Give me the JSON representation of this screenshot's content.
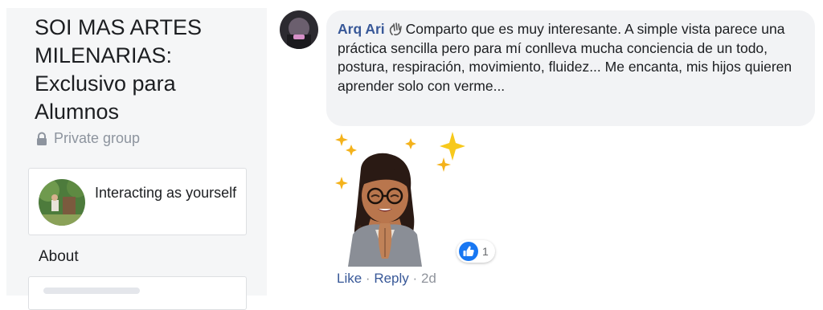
{
  "sidebar": {
    "group_title": "SOI MAS ARTES MILENARIAS: Exclusivo para Alumnos",
    "privacy": "Private group",
    "interacting": "Interacting as yourself",
    "about": "About"
  },
  "comment": {
    "author": "Arq Ari",
    "text": "Comparto que es muy interesante. A simple vista parece una práctica sencilla pero para mí conlleva mucha conciencia de un todo, postura, respiración, movimiento, fluidez... Me encanta, mis hijos quieren aprender solo con verme...",
    "reaction_count": "1",
    "like_label": "Like",
    "separator": "·",
    "reply_label": "Reply",
    "timestamp": "2d"
  },
  "colors": {
    "link": "#385898",
    "bubble": "#f2f3f5",
    "sidebar": "#f5f6f7",
    "like_blue": "#1877f2"
  }
}
